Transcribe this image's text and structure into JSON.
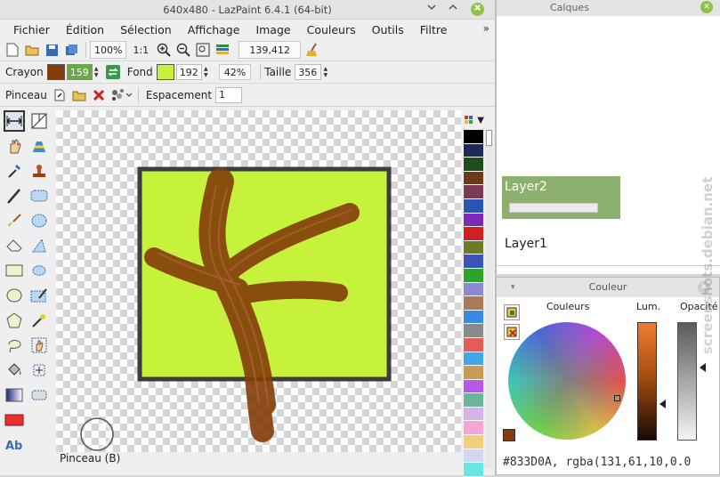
{
  "window": {
    "title": "640x480 - LazPaint 6.4.1 (64-bit)",
    "min_icon": "chevron-down-icon",
    "max_icon": "chevron-up-icon",
    "close_icon": "close-icon"
  },
  "menu": {
    "items": [
      "Fichier",
      "Édition",
      "Sélection",
      "Affichage",
      "Image",
      "Couleurs",
      "Outils",
      "Filtre"
    ],
    "more": "»"
  },
  "toolbar": {
    "zoom": "100%",
    "ratio": "1:1",
    "coords": "139,412"
  },
  "brush_bar": {
    "pen_label": "Crayon",
    "pen_color": "#833d0a",
    "pen_value": "159",
    "bg_label": "Fond",
    "bg_color": "#c6f23b",
    "bg_value": "192",
    "opacity": "42%",
    "size_label": "Taille",
    "size_value": "356"
  },
  "brush_row": {
    "tool_label": "Pinceau",
    "spacing_label": "Espacement",
    "spacing_value": "1"
  },
  "palette": {
    "colors": [
      "#000000",
      "#1c2a55",
      "#1e4d1e",
      "#6e3a1a",
      "#7a3a55",
      "#2a55b5",
      "#7a2ab5",
      "#d02020",
      "#6e7a2a",
      "#3a55b5",
      "#2aa52a",
      "#8a8ad0",
      "#a87a5a",
      "#3a8ae5",
      "#8a8a8a",
      "#e55a5a",
      "#45a5e5",
      "#c89a55",
      "#b55ae5",
      "#6ab59a",
      "#d5b5e5",
      "#f5a5d5",
      "#f0d07a",
      "#d5d5f0",
      "#6ae5e5"
    ]
  },
  "status": {
    "text": "Pinceau (B)"
  },
  "layers": {
    "title": "Calques",
    "items": [
      "Layer2",
      "Layer1"
    ]
  },
  "color_panel": {
    "title": "Couleur",
    "wheel_label": "Couleurs",
    "lum_label": "Lum.",
    "opacity_label": "Opacité",
    "current": "#833d0a",
    "hex_text": "#833D0A, rgba(131,61,10,0.0"
  },
  "watermark": "screenshots.debian.net"
}
